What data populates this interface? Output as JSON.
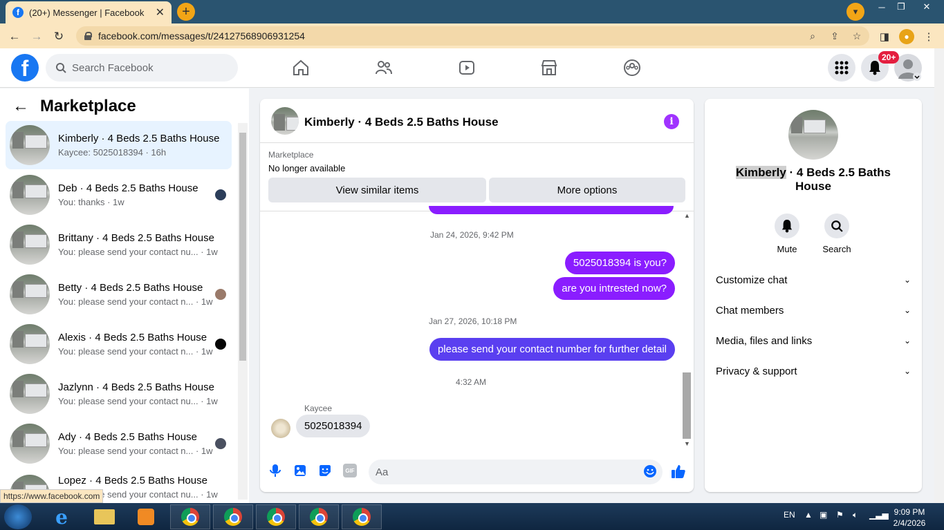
{
  "browser": {
    "tab_title": "(20+) Messenger | Facebook",
    "url": "facebook.com/messages/t/24127568906931254",
    "status_url": "https://www.facebook.com"
  },
  "header": {
    "search_placeholder": "Search Facebook",
    "notification_badge": "20+"
  },
  "sidebar": {
    "title": "Marketplace",
    "conversations": [
      {
        "name": "Kimberly · 4 Beds 2.5 Baths House",
        "sub": "Kaycee: 5025018394 · 16h",
        "active": true
      },
      {
        "name": "Deb · 4 Beds 2.5 Baths House",
        "sub": "You: thanks · 1w"
      },
      {
        "name": "Brittany · 4 Beds 2.5 Baths House",
        "sub": "You: please send your contact nu...   · 1w"
      },
      {
        "name": "Betty · 4 Beds 2.5 Baths House",
        "sub": "You: please send your contact n... · 1w"
      },
      {
        "name": "Alexis · 4 Beds 2.5 Baths House",
        "sub": "You: please send your contact n... · 1w"
      },
      {
        "name": "Jazlynn · 4 Beds 2.5 Baths House",
        "sub": "You: please send your contact nu...   · 1w"
      },
      {
        "name": "Ady · 4 Beds 2.5 Baths House",
        "sub": "You: please send your contact n... · 1w"
      },
      {
        "name": "Lopez · 4 Beds 2.5 Baths House",
        "sub": "You: please send your contact nu...   · 1w"
      }
    ]
  },
  "chat": {
    "title": "Kimberly · 4 Beds 2.5 Baths House",
    "marketplace_label": "Marketplace",
    "listing_status": "No longer available",
    "btn_similar": "View similar items",
    "btn_more": "More options",
    "ts1": "Jan 24, 2026, 9:42 PM",
    "msg1": "5025018394 is you?",
    "msg2": "are you intrested now?",
    "ts2": "Jan 27, 2026, 10:18 PM",
    "msg3": "please send your contact number for further detail",
    "ts3": "4:32 AM",
    "sender": "Kaycee",
    "msg4": "5025018394",
    "composer_placeholder": "Aa",
    "gif_label": "GIF"
  },
  "details": {
    "name_first": "Kimberly",
    "name_rest": " · 4 Beds 2.5 Baths House",
    "mute": "Mute",
    "search": "Search",
    "items": [
      "Customize chat",
      "Chat members",
      "Media, files and links",
      "Privacy & support"
    ]
  },
  "taskbar": {
    "lang": "EN",
    "time": "9:09 PM",
    "date": "2/4/2026"
  }
}
